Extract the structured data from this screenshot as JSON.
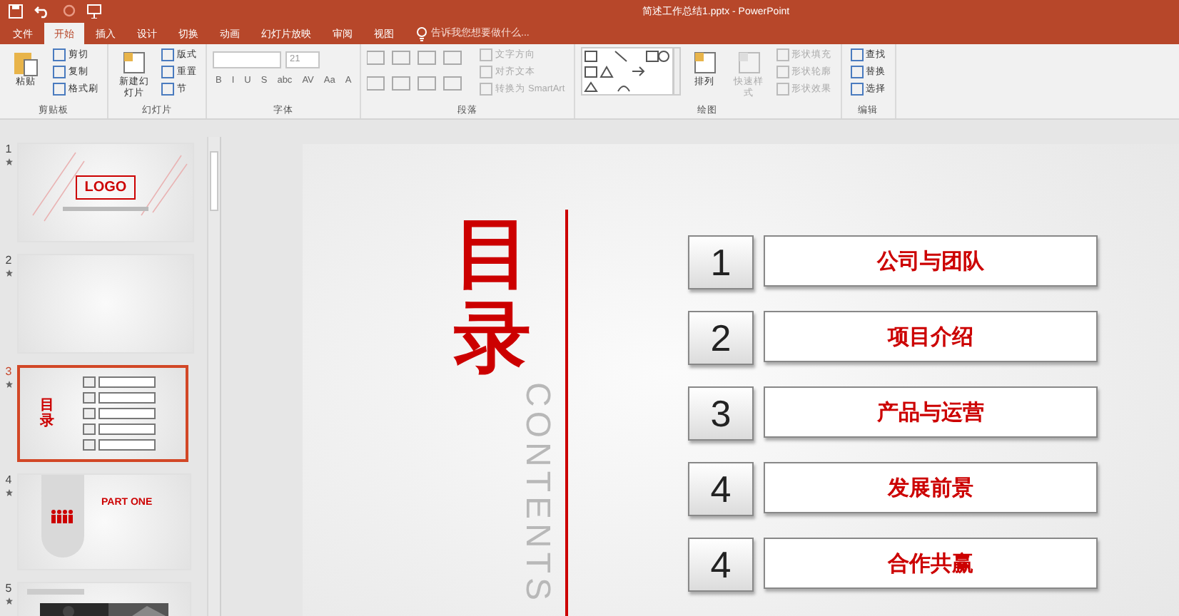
{
  "title_bar": {
    "title": "简述工作总结1.pptx - PowerPoint"
  },
  "tabs": [
    {
      "label": "文件",
      "selected": false
    },
    {
      "label": "开始",
      "selected": true
    },
    {
      "label": "插入",
      "selected": false
    },
    {
      "label": "设计",
      "selected": false
    },
    {
      "label": "切换",
      "selected": false
    },
    {
      "label": "动画",
      "selected": false
    },
    {
      "label": "幻灯片放映",
      "selected": false
    },
    {
      "label": "审阅",
      "selected": false
    },
    {
      "label": "视图",
      "selected": false
    }
  ],
  "tell_me": {
    "placeholder": "告诉我您想要做什么..."
  },
  "ribbon_groups": [
    {
      "label": "剪贴板",
      "items": [
        {
          "kind": "large",
          "label": "粘贴",
          "disabled": false
        },
        {
          "kind": "small",
          "label": "剪切",
          "disabled": false
        },
        {
          "kind": "small",
          "label": "复制",
          "disabled": false
        },
        {
          "kind": "small",
          "label": "格式刷",
          "disabled": false
        }
      ]
    },
    {
      "label": "幻灯片",
      "items": [
        {
          "kind": "large",
          "label": "新建幻灯片",
          "disabled": false
        },
        {
          "kind": "small",
          "label": "版式",
          "disabled": false
        },
        {
          "kind": "small",
          "label": "重置",
          "disabled": false
        },
        {
          "kind": "small",
          "label": "节",
          "disabled": false
        }
      ]
    },
    {
      "label": "字体",
      "items": [
        {
          "kind": "font",
          "size": "21",
          "formats": [
            "B",
            "I",
            "U",
            "S",
            "abc",
            "AV",
            "Aa",
            "A"
          ]
        }
      ]
    },
    {
      "label": "段落",
      "items": [
        {
          "kind": "paragraph"
        },
        {
          "kind": "small",
          "label": "文字方向",
          "disabled": true
        },
        {
          "kind": "small",
          "label": "对齐文本",
          "disabled": true
        },
        {
          "kind": "small",
          "label": "转换为 SmartArt",
          "disabled": true
        }
      ]
    },
    {
      "label": "绘图",
      "items": [
        {
          "kind": "shapes"
        },
        {
          "kind": "large",
          "label": "排列",
          "disabled": false
        },
        {
          "kind": "large",
          "label": "快速样式",
          "disabled": true
        },
        {
          "kind": "small",
          "label": "形状填充",
          "disabled": true
        },
        {
          "kind": "small",
          "label": "形状轮廓",
          "disabled": true
        },
        {
          "kind": "small",
          "label": "形状效果",
          "disabled": true
        }
      ]
    },
    {
      "label": "编辑",
      "items": [
        {
          "kind": "small",
          "label": "查找",
          "disabled": false
        },
        {
          "kind": "small",
          "label": "替换",
          "disabled": false
        },
        {
          "kind": "small",
          "label": "选择",
          "disabled": false
        }
      ]
    }
  ],
  "thumbnails": [
    {
      "number": "1",
      "selected": false,
      "animated": true,
      "kind": "logo",
      "text": "LOGO"
    },
    {
      "number": "2",
      "selected": false,
      "animated": true,
      "kind": "blank"
    },
    {
      "number": "3",
      "selected": true,
      "animated": true,
      "kind": "contents",
      "text": "目录"
    },
    {
      "number": "4",
      "selected": false,
      "animated": true,
      "kind": "part",
      "text": "PART ONE"
    },
    {
      "number": "5",
      "selected": false,
      "animated": true
    }
  ],
  "slide": {
    "title": "目录",
    "subtitle": "CONTENTS",
    "items": [
      {
        "number": "1",
        "label": "公司与团队"
      },
      {
        "number": "2",
        "label": "项目介绍"
      },
      {
        "number": "3",
        "label": "产品与运营"
      },
      {
        "number": "4",
        "label": "发展前景"
      },
      {
        "number": "4",
        "label": "合作共赢"
      }
    ]
  }
}
